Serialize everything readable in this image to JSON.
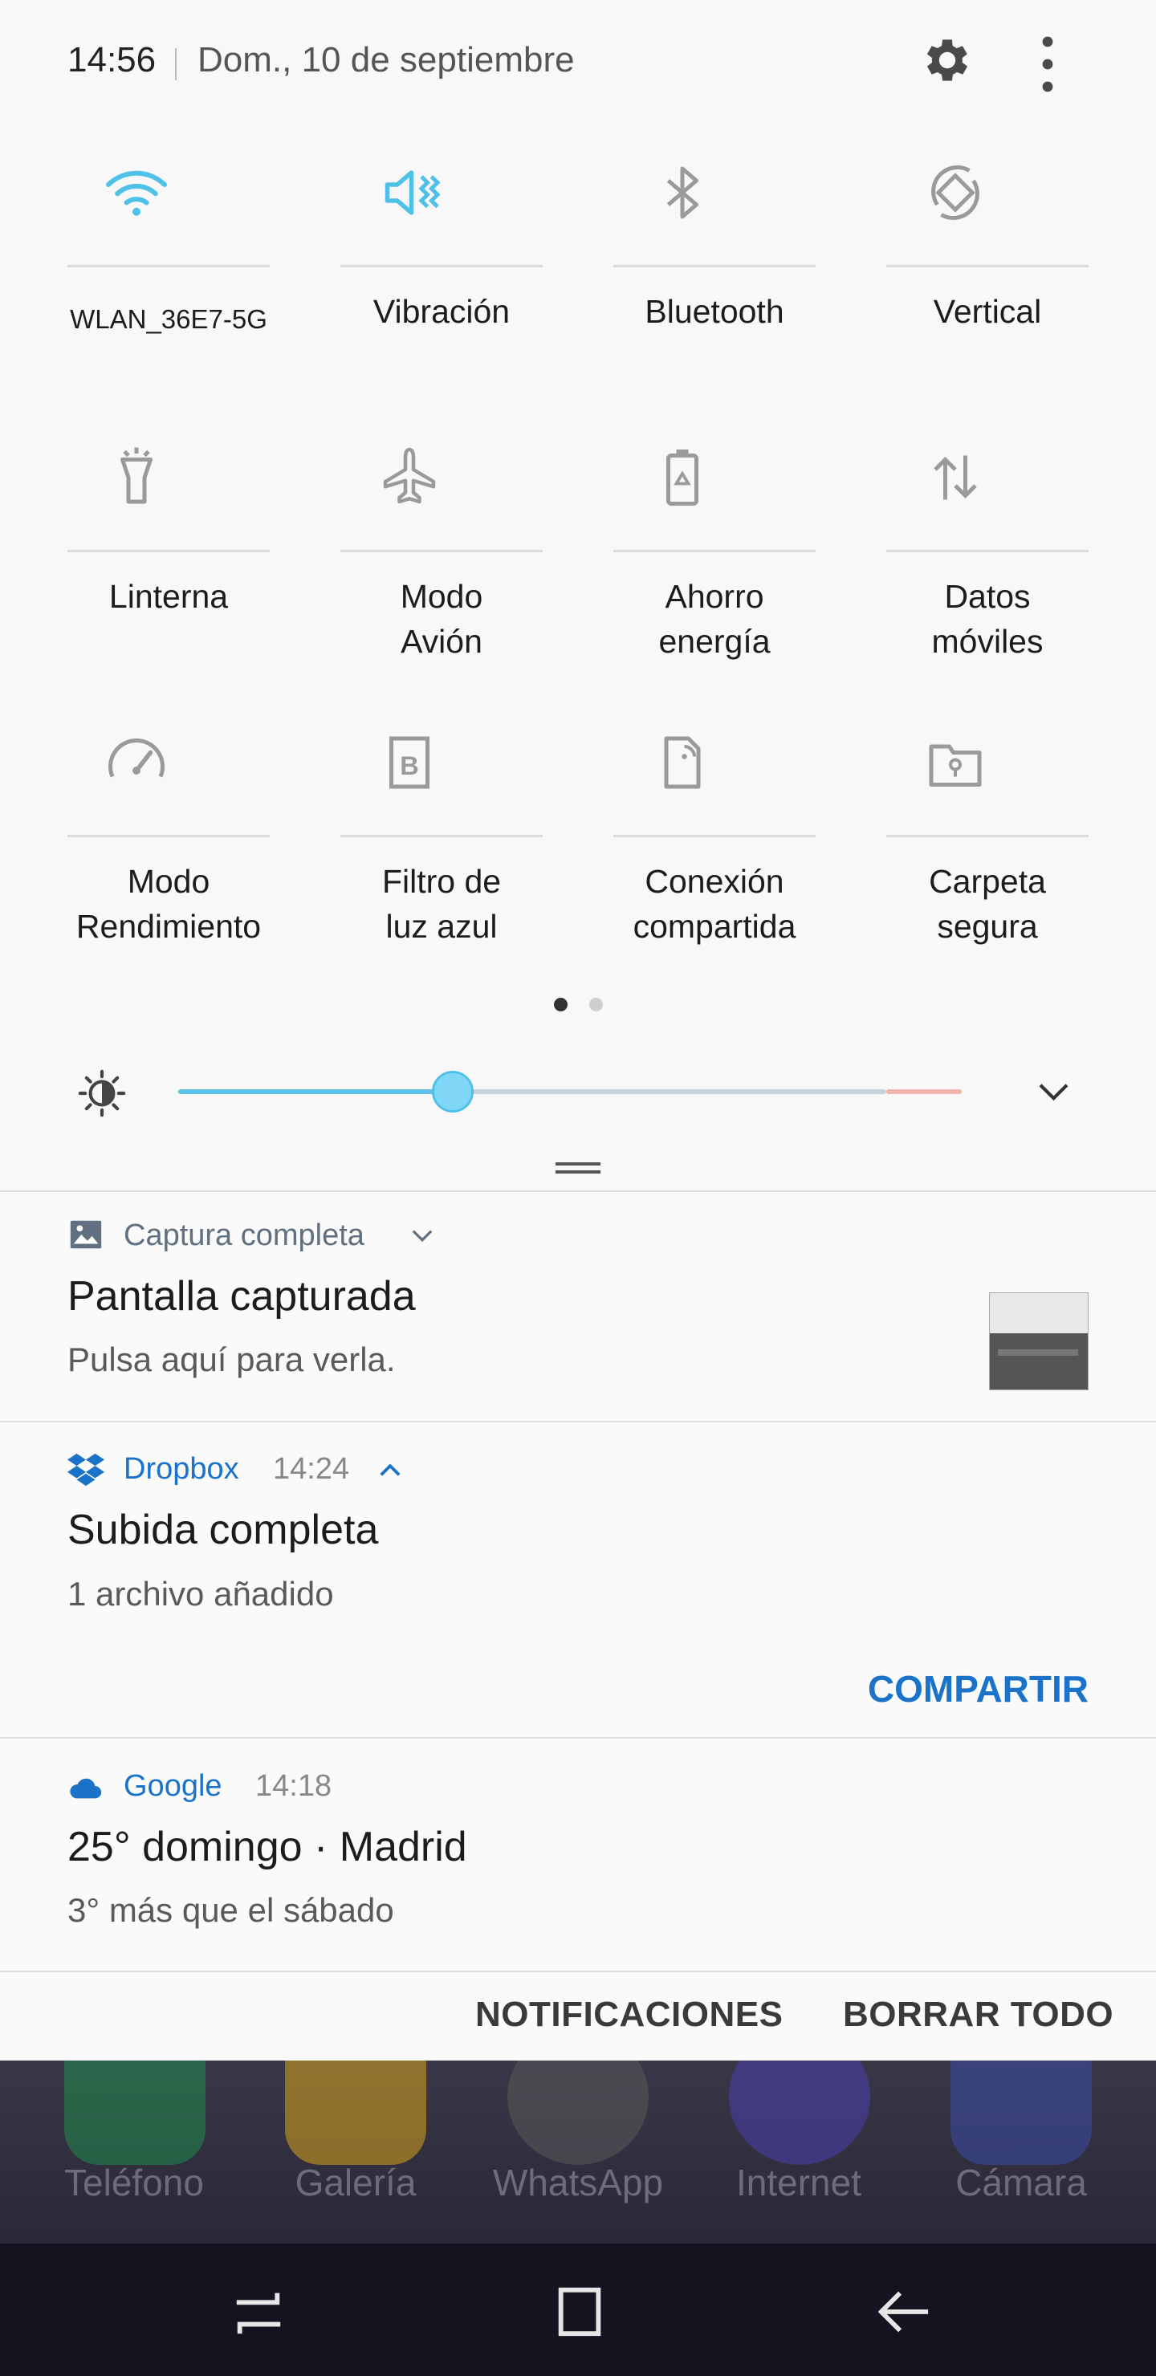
{
  "status": {
    "time": "14:56",
    "date": "Dom., 10 de septiembre",
    "settings_icon": "gear-icon",
    "more_icon": "more-vertical-icon"
  },
  "tiles": [
    {
      "label": "WLAN_36E7-5G",
      "icon": "wifi-icon",
      "active": true
    },
    {
      "label": "Vibración",
      "icon": "vibrate-icon",
      "active": true
    },
    {
      "label": "Bluetooth",
      "icon": "bluetooth-icon",
      "active": false
    },
    {
      "label": "Vertical",
      "icon": "rotation-icon",
      "active": false
    },
    {
      "label": "Linterna",
      "icon": "flashlight-icon",
      "active": false
    },
    {
      "label": "Modo\nAvión",
      "icon": "airplane-icon",
      "active": false
    },
    {
      "label": "Ahorro\nenergía",
      "icon": "battery-saver-icon",
      "active": false
    },
    {
      "label": "Datos\nmóviles",
      "icon": "mobile-data-icon",
      "active": false
    },
    {
      "label": "Modo\nRendimiento",
      "icon": "performance-gauge-icon",
      "active": false
    },
    {
      "label": "Filtro de\nluz azul",
      "icon": "blue-light-filter-icon",
      "active": false
    },
    {
      "label": "Conexión\ncompartida",
      "icon": "hotspot-icon",
      "active": false
    },
    {
      "label": "Carpeta\nsegura",
      "icon": "secure-folder-icon",
      "active": false
    }
  ],
  "pager": {
    "pages": 2,
    "current": 1
  },
  "brightness": {
    "level": 0.32
  },
  "notifications": [
    {
      "app": "Captura completa",
      "icon": "image-icon",
      "title": "Pantalla capturada",
      "body": "Pulsa aquí para verla.",
      "app_color": "#607080"
    },
    {
      "app": "Dropbox",
      "time": "14:24",
      "icon": "dropbox-icon",
      "title": "Subida completa",
      "body": "1 archivo añadido",
      "action": "COMPARTIR",
      "app_color": "#1a73c9"
    },
    {
      "app": "Google",
      "time": "14:18",
      "icon": "cloud-icon",
      "title": "25° domingo · Madrid",
      "body": "3° más que el sábado",
      "app_color": "#1a73c9"
    }
  ],
  "footer": {
    "notifications_settings": "NOTIFICACIONES",
    "clear_all": "BORRAR TODO"
  },
  "home": {
    "apps": [
      {
        "label": "Teléfono",
        "color": "#1f8a4c"
      },
      {
        "label": "Galería",
        "color": "#d8a21c"
      },
      {
        "label": "WhatsApp",
        "color": "#3a3a3a"
      },
      {
        "label": "Internet",
        "color": "#4b3fae"
      },
      {
        "label": "Cámara",
        "color": "#3b4aa8"
      }
    ]
  },
  "colors": {
    "accent": "#4fc1e9",
    "link": "#1a73c9",
    "inactive_icon": "#9a9a9a"
  }
}
